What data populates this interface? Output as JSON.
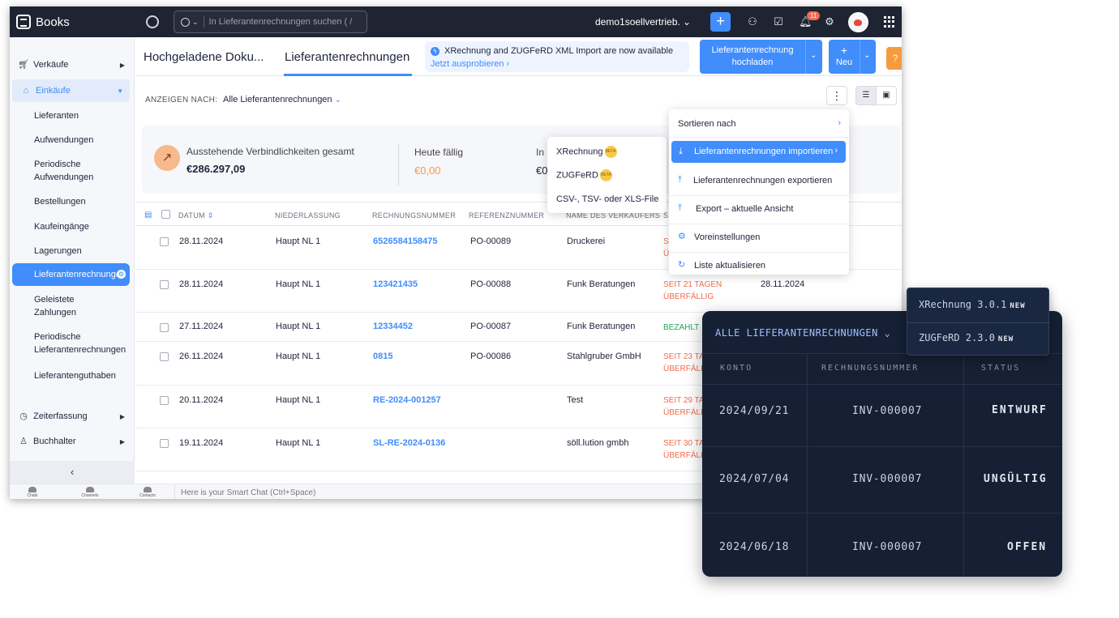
{
  "app": {
    "name": "Books",
    "org": "demo1soellvertrieb.",
    "notification_count": "11"
  },
  "search": {
    "placeholder": "In Lieferantenrechnungen suchen ( /"
  },
  "sidebar": {
    "sales": "Verkäufe",
    "purchases": "Einkäufe",
    "sub": [
      "Lieferanten",
      "Aufwendungen",
      "Periodische Aufwendungen",
      "Bestellungen",
      "Kaufeingänge",
      "Lagerungen",
      "Lieferantenrechnungen",
      "Geleistete Zahlungen",
      "Periodische Lieferantenrechnungen",
      "Lieferantenguthaben"
    ],
    "time": "Zeiterfassung",
    "accountant": "Buchhalter"
  },
  "chatbar": {
    "items": [
      "Chats",
      "Channels",
      "Contacts"
    ],
    "hint": "Here is your Smart Chat (Ctrl+Space)"
  },
  "tabs": {
    "uploaded": "Hochgeladene Doku...",
    "bills": "Lieferantenrechnungen"
  },
  "banner": {
    "title": "XRechnung and ZUGFeRD XML Import are now available",
    "link": "Jetzt ausprobieren ›"
  },
  "buttons": {
    "upload_l1": "Lieferantenrechnung",
    "upload_l2": "hochladen",
    "new_plus": "+",
    "new": "Neu",
    "help": "?"
  },
  "filter": {
    "label": "ANZEIGEN NACH:",
    "value": "Alle Lieferantenrechnungen"
  },
  "summary": {
    "label1": "Ausstehende Verbindlichkeiten gesamt",
    "value1": "€286.297,09",
    "label2": "Heute fällig",
    "value2": "€0,00",
    "label3": "In",
    "value3": "€0"
  },
  "table": {
    "headers": [
      "DATUM",
      "NIEDERLASSUNG",
      "RECHNUNGSNUMMER",
      "REFERENZNUMMER",
      "NAME DES VERKÄUFERS",
      "S"
    ],
    "rows": [
      {
        "date": "28.11.2024",
        "branch": "Haupt NL 1",
        "number": "6526584158475",
        "ref": "PO-00089",
        "vendor": "Druckerei",
        "status1": "S",
        "status2": "Ü",
        "due": ""
      },
      {
        "date": "28.11.2024",
        "branch": "Haupt NL 1",
        "number": "123421435",
        "ref": "PO-00088",
        "vendor": "Funk Beratungen",
        "status1": "SEIT 21 TAGEN",
        "status2": "ÜBERFÄLLIG",
        "due": "28.11.2024"
      },
      {
        "date": "27.11.2024",
        "branch": "Haupt NL 1",
        "number": "12334452",
        "ref": "PO-00087",
        "vendor": "Funk Beratungen",
        "status1": "BEZAHLT",
        "status2": "",
        "due": ""
      },
      {
        "date": "26.11.2024",
        "branch": "Haupt NL 1",
        "number": "0815",
        "ref": "PO-00086",
        "vendor": "Stahlgruber GmbH",
        "status1": "SEIT 23 TA",
        "status2": "ÜBERFÄLLI",
        "due": ""
      },
      {
        "date": "20.11.2024",
        "branch": "Haupt NL 1",
        "number": "RE-2024-001257",
        "ref": "",
        "vendor": "Test",
        "status1": "SEIT 29 TA",
        "status2": "ÜBERFÄLLI",
        "due": ""
      },
      {
        "date": "19.11.2024",
        "branch": "Haupt NL 1",
        "number": "SL-RE-2024-0136",
        "ref": "",
        "vendor": "söll.lution gmbh",
        "status1": "SEIT 30 TA",
        "status2": "ÜBERFÄLLI",
        "due": ""
      }
    ]
  },
  "menu": {
    "sort": "Sortieren nach",
    "import": "Lieferantenrechnungen importieren",
    "export": "Lieferantenrechnungen exportieren",
    "export_view": "Export – aktuelle Ansicht",
    "prefs": "Voreinstellungen",
    "refresh": "Liste aktualisieren"
  },
  "submenu": {
    "xr": "XRechnung",
    "zf": "ZUGFeRD",
    "csv": "CSV-, TSV- oder XLS-File",
    "beta": "BETA"
  },
  "dark_panel": {
    "title": "ALLE LIEFERANTENRECHNUNGEN",
    "headers": [
      "KONTO",
      "RECHNUNGSNUMMER",
      "STATUS"
    ],
    "rows": [
      {
        "konto": "2024/09/21",
        "nr": "INV-000007",
        "status": "ENTWURF"
      },
      {
        "konto": "2024/07/04",
        "nr": "INV-000007",
        "status": "UNGÜLTIG"
      },
      {
        "konto": "2024/06/18",
        "nr": "INV-000007",
        "status": "OFFEN"
      }
    ],
    "popover": [
      {
        "name": "XRechnung 3.0.1",
        "tag": "NEW"
      },
      {
        "name": "ZUGFeRD 2.3.0",
        "tag": "NEW"
      }
    ]
  }
}
